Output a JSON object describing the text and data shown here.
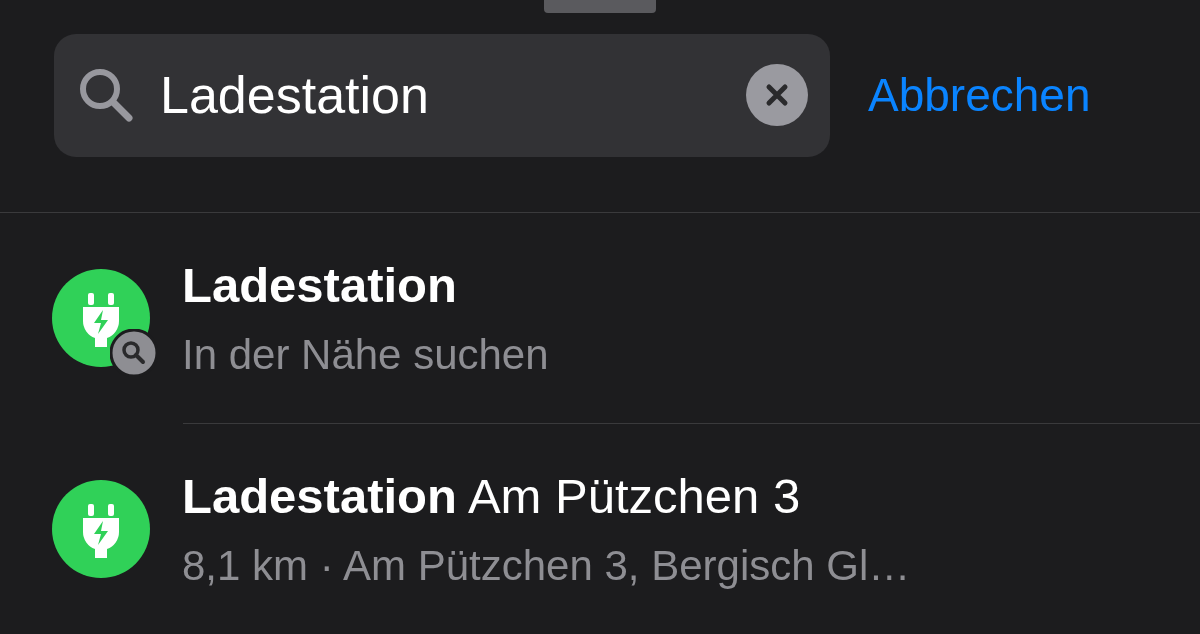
{
  "search": {
    "value": "Ladestation",
    "cancel": "Abbrechen"
  },
  "results": [
    {
      "title": "Ladestation",
      "subtitle": "In der Nähe suchen",
      "kind": "search"
    },
    {
      "title": "**Ladestation** Am Pützchen 3",
      "subtitle": "8,1 km · Am Pützchen 3, Bergisch Gl…",
      "kind": "place"
    }
  ]
}
